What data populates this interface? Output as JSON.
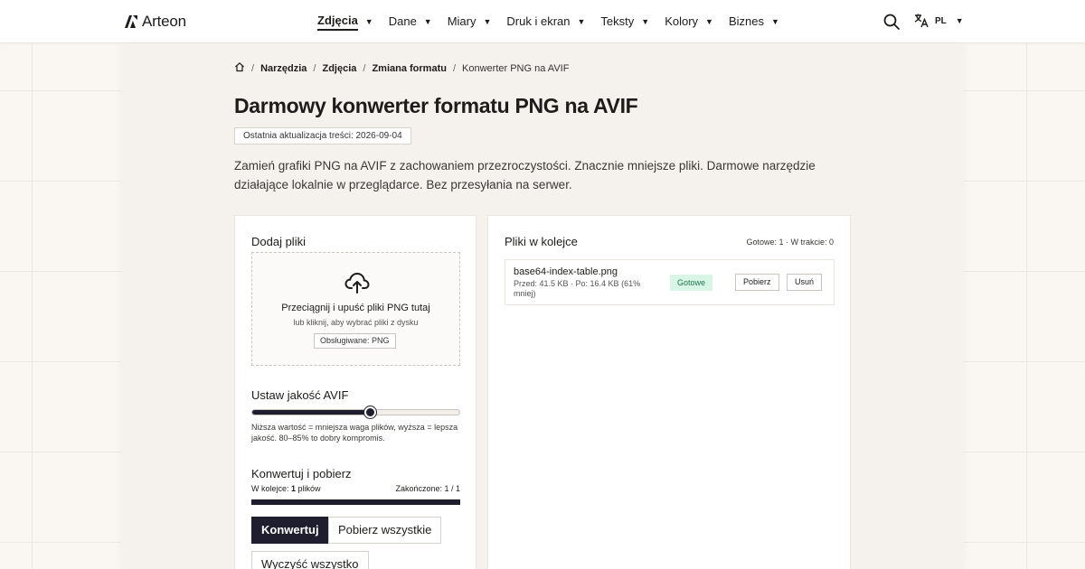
{
  "header": {
    "logo_text": "Arteon",
    "nav": [
      {
        "label": "Zdjęcia",
        "active": true
      },
      {
        "label": "Dane"
      },
      {
        "label": "Miary"
      },
      {
        "label": "Druk i ekran"
      },
      {
        "label": "Teksty"
      },
      {
        "label": "Kolory"
      },
      {
        "label": "Biznes"
      }
    ],
    "language": "PL"
  },
  "breadcrumb": {
    "items": [
      "Narzędzia",
      "Zdjęcia",
      "Zmiana formatu"
    ],
    "current": "Konwerter PNG na AVIF"
  },
  "page": {
    "title": "Darmowy konwerter formatu PNG na AVIF",
    "updated": "Ostatnia aktualizacja treści: 2026-09-04",
    "lead": "Zamień grafiki PNG na AVIF z zachowaniem przezroczystości. Znacznie mniejsze pliki. Darmowe narzędzie działające lokalnie w przeglądarce. Bez przesyłania na serwer."
  },
  "add_files": {
    "heading": "Dodaj pliki",
    "drop_title": "Przeciągnij i upuść pliki PNG tutaj",
    "drop_sub": "lub kliknij, aby wybrać pliki z dysku",
    "supported": "Obsługiwane: PNG"
  },
  "quality": {
    "heading": "Ustaw jakość AVIF",
    "value_fraction": 0.57,
    "hint": "Niższa wartość = mniejsza waga plików, wyższa = lepsza jakość. 80–85% to dobry kompromis."
  },
  "convert": {
    "heading": "Konwertuj i pobierz",
    "queue_prefix": "W kolejce: ",
    "queue_count": "1",
    "queue_suffix": " plików",
    "finished": "Zakończone: 1 / 1",
    "progress_fraction": 1.0,
    "convert_label": "Konwertuj",
    "download_all_label": "Pobierz wszystkie",
    "clear_label": "Wyczyść wszystko"
  },
  "queue": {
    "heading": "Pliki w kolejce",
    "summary": "Gotowe: 1 · W trakcie: 0",
    "files": [
      {
        "name": "base64-index-table.png",
        "meta": "Przed: 41.5 KB · Po: 16.4 KB (61% mniej)",
        "status": "Gotowe",
        "download_label": "Pobierz",
        "remove_label": "Usuń"
      }
    ]
  },
  "colors": {
    "primary": "#1e1e2e",
    "done_bg": "#d9f5e6",
    "done_text": "#1d7a4a"
  }
}
